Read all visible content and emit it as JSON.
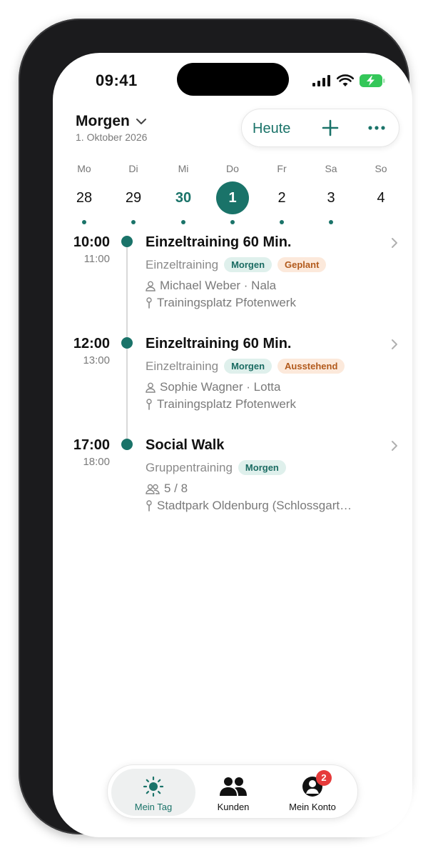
{
  "status": {
    "time": "09:41"
  },
  "header": {
    "title": "Morgen",
    "date": "1. Oktober 2026",
    "today_button": "Heute"
  },
  "week": [
    {
      "weekday": "Mo",
      "date": "28"
    },
    {
      "weekday": "Di",
      "date": "29"
    },
    {
      "weekday": "Mi",
      "date": "30"
    },
    {
      "weekday": "Do",
      "date": "1"
    },
    {
      "weekday": "Fr",
      "date": "2"
    },
    {
      "weekday": "Sa",
      "date": "3"
    },
    {
      "weekday": "So",
      "date": "4"
    }
  ],
  "events": [
    {
      "start": "10:00",
      "end": "11:00",
      "title": "Einzeltraining 60 Min.",
      "type": "Einzeltraining",
      "badge_day": "Morgen",
      "badge_status": "Geplant",
      "client": "Michael Weber · Nala",
      "location": "Trainingsplatz Pfotenwerk"
    },
    {
      "start": "12:00",
      "end": "13:00",
      "title": "Einzeltraining 60 Min.",
      "type": "Einzeltraining",
      "badge_day": "Morgen",
      "badge_status": "Ausstehend",
      "client": "Sophie Wagner · Lotta",
      "location": "Trainingsplatz Pfotenwerk"
    },
    {
      "start": "17:00",
      "end": "18:00",
      "title": "Social Walk",
      "type": "Gruppentraining",
      "badge_day": "Morgen",
      "participants": "5 / 8",
      "location": "Stadtpark Oldenburg (Schlossgart…"
    }
  ],
  "tabs": [
    {
      "label": "Mein Tag",
      "icon": "sun-icon"
    },
    {
      "label": "Kunden",
      "icon": "people-icon"
    },
    {
      "label": "Mein Konto",
      "icon": "account-icon",
      "badge": "2"
    }
  ],
  "colors": {
    "accent": "#1a7369",
    "badge_red": "#e63a3a"
  }
}
